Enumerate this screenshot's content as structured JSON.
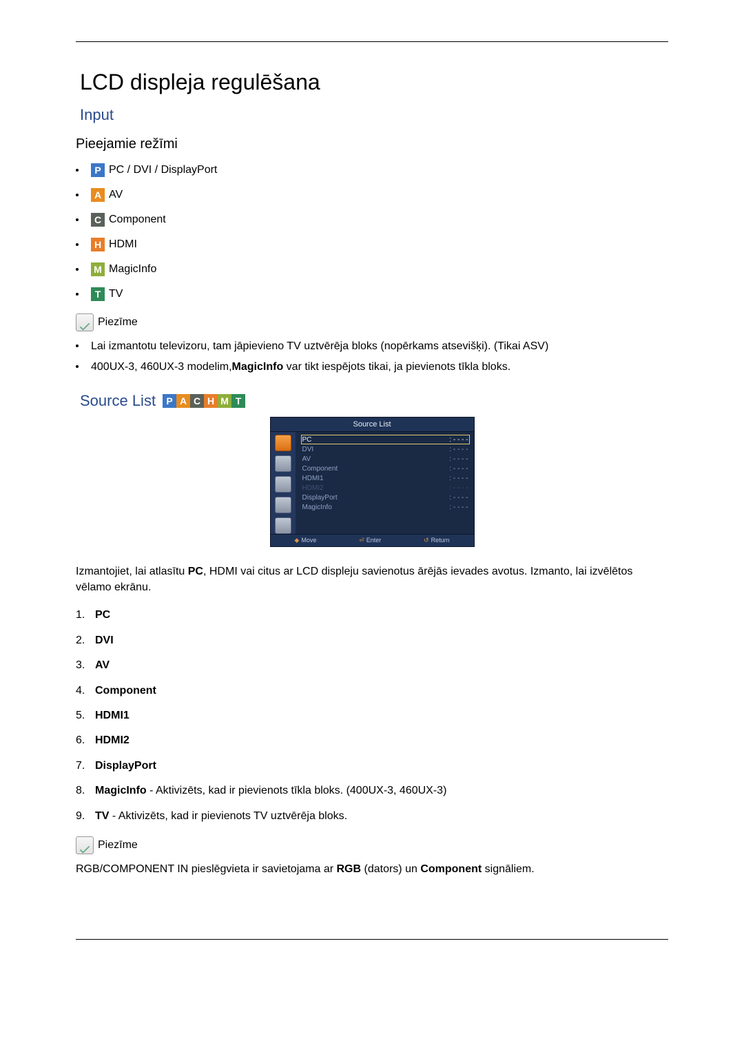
{
  "title": "LCD displeja regulēšana",
  "input": {
    "heading": "Input",
    "modes_heading": "Pieejamie režīmi",
    "modes": [
      {
        "badge": "P",
        "cls": "b-P",
        "label": "PC / DVI / DisplayPort"
      },
      {
        "badge": "A",
        "cls": "b-A",
        "label": "AV"
      },
      {
        "badge": "C",
        "cls": "b-C",
        "label": "Component"
      },
      {
        "badge": "H",
        "cls": "b-H",
        "label": "HDMI"
      },
      {
        "badge": "M",
        "cls": "b-M",
        "label": "MagicInfo"
      },
      {
        "badge": "T",
        "cls": "b-T",
        "label": "TV"
      }
    ],
    "note_label": "Piezīme",
    "notes": [
      "Lai izmantotu televizoru, tam jāpievieno TV uztvērēja bloks (nopērkams atsevišķi). (Tikai ASV)",
      "400UX-3, 460UX-3 modelim,<b>MagicInfo</b> var tikt iespējots tikai, ja pievienots tīkla bloks."
    ]
  },
  "source_list": {
    "heading": "Source List",
    "strip": [
      "P",
      "A",
      "C",
      "H",
      "M",
      "T"
    ],
    "strip_cls": [
      "b-P",
      "b-A",
      "b-C",
      "b-H",
      "b-M",
      "b-T"
    ],
    "osd": {
      "title": "Source List",
      "rows": [
        {
          "l": "PC",
          "r": "- - - -",
          "state": "sel"
        },
        {
          "l": "DVI",
          "r": "- - - -",
          "state": ""
        },
        {
          "l": "AV",
          "r": "- - - -",
          "state": ""
        },
        {
          "l": "Component",
          "r": "- - - -",
          "state": ""
        },
        {
          "l": "HDMI1",
          "r": "- - - -",
          "state": ""
        },
        {
          "l": "HDMI2",
          "r": "- - - -",
          "state": "dis"
        },
        {
          "l": "DisplayPort",
          "r": "- - - -",
          "state": ""
        },
        {
          "l": "MagicInfo",
          "r": "- - - -",
          "state": ""
        }
      ],
      "foot": {
        "move": "Move",
        "enter": "Enter",
        "ret": "Return"
      }
    },
    "intro": "Izmantojiet, lai atlasītu <b>PC</b>, HDMI vai citus ar LCD displeju savienotus ārējās ievades avotus. Izmanto, lai izvēlētos vēlamo ekrānu.",
    "items": [
      {
        "n": "1.",
        "html": "<b>PC</b>"
      },
      {
        "n": "2.",
        "html": "<b>DVI</b>"
      },
      {
        "n": "3.",
        "html": "<b>AV</b>"
      },
      {
        "n": "4.",
        "html": "<b>Component</b>"
      },
      {
        "n": "5.",
        "html": "<b>HDMI1</b>"
      },
      {
        "n": "6.",
        "html": "<b>HDMI2</b>"
      },
      {
        "n": "7.",
        "html": "<b>DisplayPort</b>"
      },
      {
        "n": "8.",
        "html": "<b>MagicInfo</b> - Aktivizēts, kad ir pievienots tīkla bloks. (400UX-3, 460UX-3)"
      },
      {
        "n": "9.",
        "html": "<b>TV</b> - Aktivizēts, kad ir pievienots TV uztvērēja bloks."
      }
    ],
    "note_label": "Piezīme",
    "note_text": "RGB/COMPONENT IN pieslēgvieta ir savietojama ar <b>RGB</b> (dators) un <b>Component</b> signāliem."
  }
}
